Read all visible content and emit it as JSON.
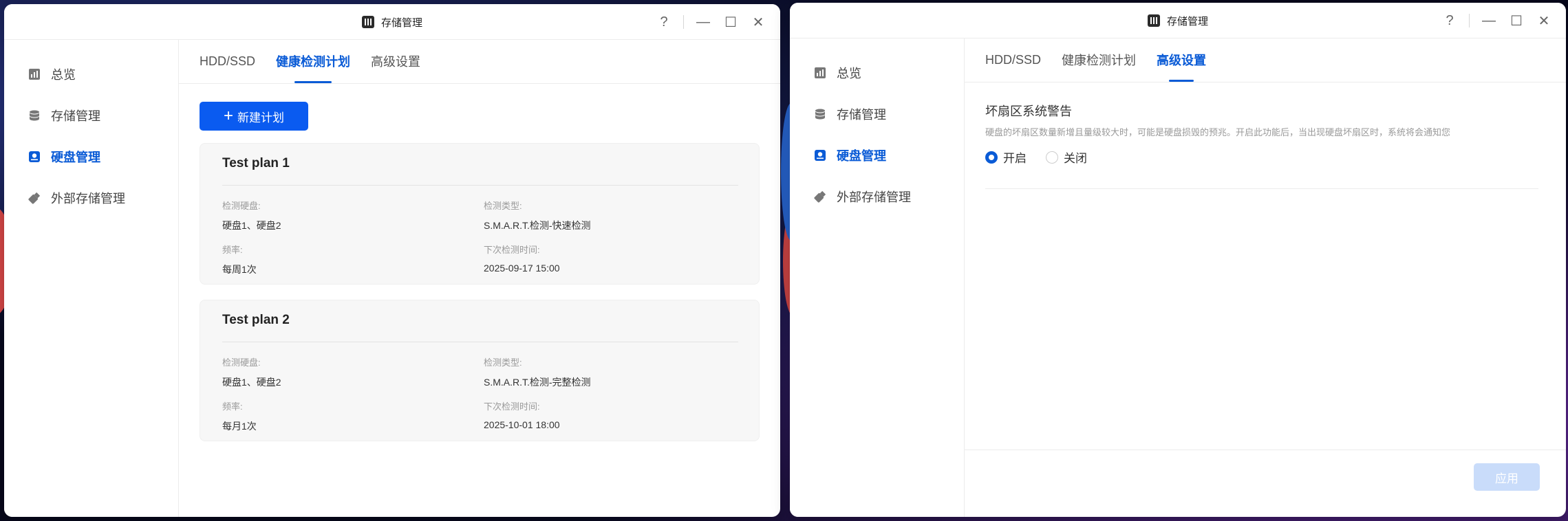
{
  "colors": {
    "accent": "#0a5bd6",
    "primary_button": "#0a5bf0",
    "apply_disabled": "#c9dcfa"
  },
  "left_window": {
    "title": "存储管理",
    "controls": {
      "help": "?",
      "minimize": "—",
      "maximize": "☐",
      "close": "✕"
    },
    "sidebar": {
      "items": [
        {
          "label": "总览",
          "icon": "chart-icon"
        },
        {
          "label": "存储管理",
          "icon": "database-icon"
        },
        {
          "label": "硬盘管理",
          "icon": "disk-icon",
          "active": true
        },
        {
          "label": "外部存储管理",
          "icon": "usb-icon"
        }
      ]
    },
    "tabs": [
      {
        "label": "HDD/SSD"
      },
      {
        "label": "健康检测计划",
        "active": true
      },
      {
        "label": "高级设置"
      }
    ],
    "new_plan_button": "新建计划",
    "plans": [
      {
        "name": "Test plan 1",
        "disks_label": "检测硬盘:",
        "disks_value": "硬盘1、硬盘2",
        "type_label": "检测类型:",
        "type_value": "S.M.A.R.T.检测-快速检测",
        "freq_label": "频率:",
        "freq_value": "每周1次",
        "next_label": "下次检测时间:",
        "next_value": "2025-09-17 15:00"
      },
      {
        "name": "Test plan 2",
        "disks_label": "检测硬盘:",
        "disks_value": "硬盘1、硬盘2",
        "type_label": "检测类型:",
        "type_value": "S.M.A.R.T.检测-完整检测",
        "freq_label": "频率:",
        "freq_value": "每月1次",
        "next_label": "下次检测时间:",
        "next_value": "2025-10-01 18:00"
      }
    ]
  },
  "right_window": {
    "title": "存储管理",
    "controls": {
      "help": "?",
      "minimize": "—",
      "maximize": "☐",
      "close": "✕"
    },
    "sidebar": {
      "items": [
        {
          "label": "总览"
        },
        {
          "label": "存储管理"
        },
        {
          "label": "硬盘管理",
          "active": true
        },
        {
          "label": "外部存储管理"
        }
      ]
    },
    "tabs": [
      {
        "label": "HDD/SSD"
      },
      {
        "label": "健康检测计划"
      },
      {
        "label": "高级设置",
        "active": true
      }
    ],
    "section_title": "坏扇区系统警告",
    "section_desc": "硬盘的坏扇区数量新增且量级较大时，可能是硬盘损毁的预兆。开启此功能后，当出现硬盘坏扇区时，系统将会通知您",
    "radio_on": "开启",
    "radio_off": "关闭",
    "selected": "开启",
    "apply_button": "应用"
  }
}
